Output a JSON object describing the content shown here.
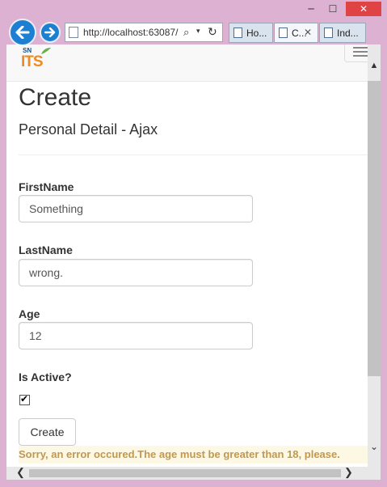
{
  "window": {
    "minimize_glyph": "─",
    "maximize_glyph": "☐",
    "close_glyph": "✕"
  },
  "browser": {
    "back_icon": "arrow-left-icon",
    "forward_icon": "arrow-right-icon",
    "address": {
      "url": "http://localhost:63087/",
      "search_glyph": "⌕",
      "dropdown_glyph": "▾",
      "refresh_glyph": "↻"
    },
    "tabs": [
      {
        "label": "Ho...",
        "active": false
      },
      {
        "label": "C...",
        "active": true,
        "close": "✕"
      },
      {
        "label": "Ind...",
        "active": false
      }
    ]
  },
  "navbar": {
    "logo": {
      "sn": "SN",
      "its": "ITS"
    }
  },
  "page": {
    "title": "Create",
    "subtitle": "Personal Detail - Ajax"
  },
  "form": {
    "first_name": {
      "label": "FirstName",
      "value": "Something"
    },
    "last_name": {
      "label": "LastName",
      "value": "wrong."
    },
    "age": {
      "label": "Age",
      "value": "12"
    },
    "is_active": {
      "label": "Is Active?",
      "checked": true,
      "check_glyph": "✔"
    },
    "submit_label": "Create"
  },
  "error_message": "Sorry, an error occured.The age must be greater than 18, please.",
  "scrollbars": {
    "up": "▲",
    "down": "⌄",
    "left": "❮",
    "right": "❯"
  },
  "colors": {
    "accent": "#1c7fd1",
    "error_text": "#c09853",
    "error_bg": "#fcf8e3",
    "logo_orange": "#f08a1c",
    "logo_blue": "#1b4e8c",
    "window_frame": "#dcb1d2"
  }
}
